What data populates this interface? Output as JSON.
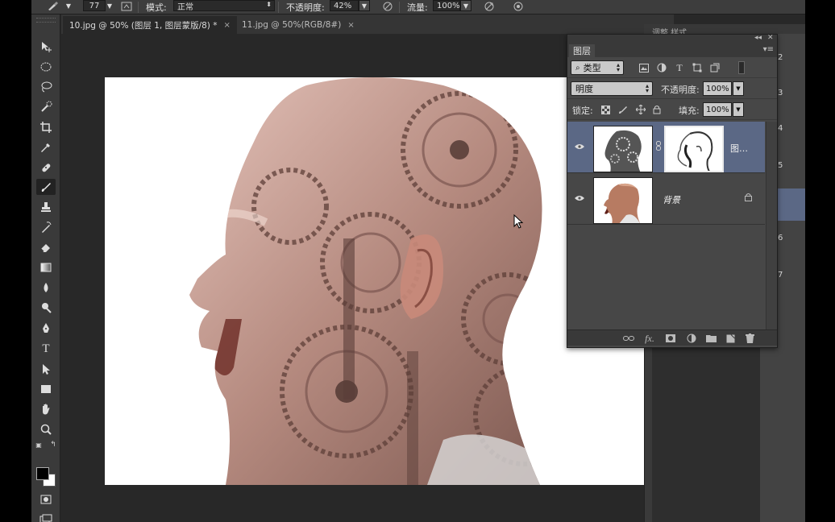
{
  "options_bar": {
    "brush_size": "77",
    "mode_label": "模式:",
    "mode_value": "正常",
    "opacity_label": "不透明度:",
    "opacity_value": "42%",
    "flow_label": "流量:",
    "flow_value": "100%"
  },
  "tabs": [
    {
      "label": "10.jpg @ 50% (图层 1, 图层蒙版/8) *",
      "close": "×"
    },
    {
      "label": "11.jpg @ 50%(RGB/8#)",
      "close": "×"
    }
  ],
  "layers_panel": {
    "title": "图层",
    "filter_type": "类型",
    "blend_mode": "明度",
    "opacity_label": "不透明度:",
    "opacity_value": "100%",
    "lock_label": "锁定:",
    "fill_label": "填充:",
    "fill_value": "100%",
    "layers": [
      {
        "name": "图…",
        "selected": true
      },
      {
        "name": "背景",
        "selected": false,
        "locked": true
      }
    ]
  },
  "dock": {
    "tabs": "调整  样式",
    "numbers": [
      "2",
      "3",
      "4",
      "5",
      "6",
      "7"
    ]
  },
  "icons": {
    "toolbar": [
      "move-icon",
      "marquee-icon",
      "lasso-icon",
      "quick-select-icon",
      "crop-icon",
      "eyedropper-icon",
      "healing-icon",
      "brush-icon",
      "stamp-icon",
      "history-brush-icon",
      "eraser-icon",
      "gradient-icon",
      "blur-icon",
      "dodge-icon",
      "pen-icon",
      "type-icon",
      "path-select-icon",
      "shape-icon",
      "hand-icon",
      "zoom-icon"
    ]
  },
  "colors": {
    "selection": "#5b6885",
    "panel_bg": "#474747",
    "app_bg": "#282828",
    "foreground": "#000000",
    "background": "#ffffff"
  }
}
